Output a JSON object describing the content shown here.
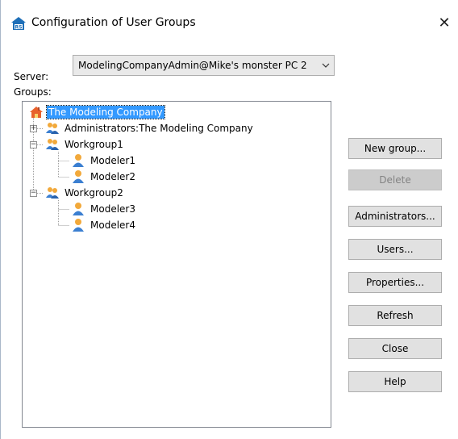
{
  "window": {
    "title": "Configuration of User Groups",
    "close_glyph": "✕"
  },
  "server": {
    "label": "Server:",
    "selected_value": "ModelingCompanyAdmin@Mike's monster PC 2"
  },
  "groups": {
    "label": "Groups:",
    "tree": {
      "root": {
        "label": "The Modeling Company",
        "icon": "company-house-icon",
        "selected": true
      },
      "nodes": [
        {
          "label": "Administrators:The Modeling Company",
          "icon": "user-group-icon",
          "expander": "+"
        },
        {
          "label": "Workgroup1",
          "icon": "user-group-icon",
          "expander": "−"
        },
        {
          "label": "Modeler1",
          "icon": "user-icon"
        },
        {
          "label": "Modeler2",
          "icon": "user-icon"
        },
        {
          "label": "Workgroup2",
          "icon": "user-group-icon",
          "expander": "−"
        },
        {
          "label": "Modeler3",
          "icon": "user-icon"
        },
        {
          "label": "Modeler4",
          "icon": "user-icon"
        }
      ]
    }
  },
  "buttons": {
    "new_group": "New group...",
    "delete": "Delete",
    "administrators": "Administrators...",
    "users": "Users...",
    "properties": "Properties...",
    "refresh": "Refresh",
    "close": "Close",
    "help": "Help"
  },
  "colors": {
    "selection": "#3399ff",
    "button_face": "#e1e1e1",
    "button_disabled": "#cccccc",
    "user_icon": "#3b7fd1",
    "user_head": "#f2a93b"
  }
}
